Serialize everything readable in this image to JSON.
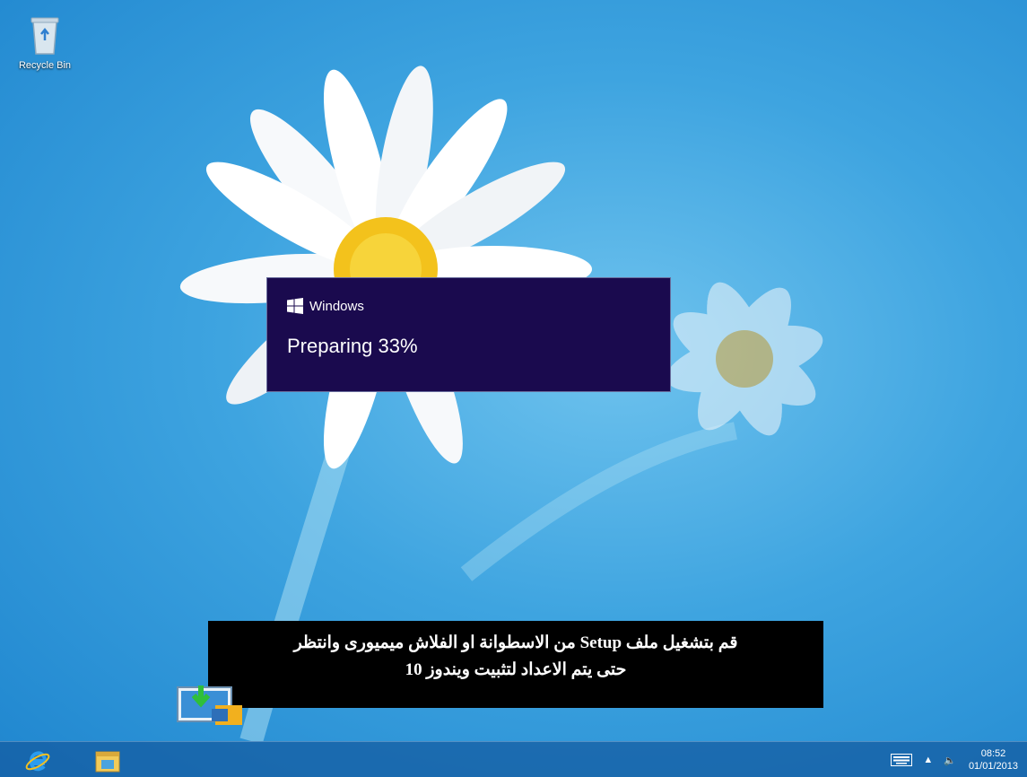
{
  "desktop": {
    "recycle_bin_label": "Recycle Bin"
  },
  "setup_dialog": {
    "brand": "Windows",
    "status": "Preparing 33%",
    "progress_percent": 33
  },
  "caption": {
    "line1": "قم بتشغيل ملف Setup من الاسطوانة او الفلاش ميميورى وانتظر",
    "line2": "حتى يتم الاعداد لتثبيت ويندوز 10"
  },
  "taskbar": {
    "pinned": [
      {
        "icon": "internet-explorer-icon"
      },
      {
        "icon": "file-explorer-icon"
      }
    ],
    "tray": {
      "time": "08:52",
      "date": "01/01/2013",
      "icons": [
        "keyboard-icon",
        "show-hidden-icons-chevron",
        "volume-icon"
      ]
    }
  },
  "colors": {
    "dialog_bg": "#1a0a4e",
    "taskbar_bg": "#1e64a8"
  }
}
